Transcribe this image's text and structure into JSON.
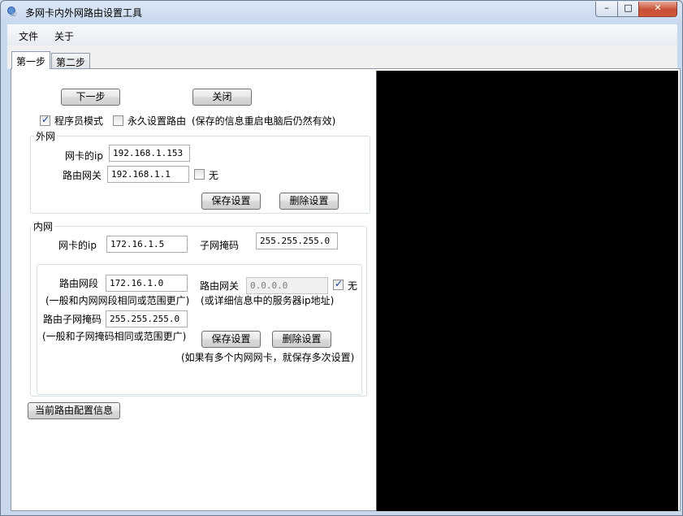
{
  "window": {
    "title": "多网卡内外网路由设置工具"
  },
  "menu": {
    "items": [
      "文件",
      "关于"
    ]
  },
  "tabs": [
    "第一步",
    "第二步"
  ],
  "top_buttons": {
    "next": "下一步",
    "close": "关闭"
  },
  "options": {
    "programmer_mode": {
      "label": "程序员模式",
      "checked": true
    },
    "persistent_route": {
      "label": "永久设置路由",
      "checked": false,
      "note": "(保存的信息重启电脑后仍然有效)"
    }
  },
  "external": {
    "legend": "外网",
    "nic_ip_label": "网卡的ip",
    "nic_ip_value": "192.168.1.153",
    "gateway_label": "路由网关",
    "gateway_value": "192.168.1.1",
    "none_label": "无",
    "none_checked": false,
    "save_label": "保存设置",
    "delete_label": "删除设置"
  },
  "internal": {
    "legend": "内网",
    "nic_ip_label": "网卡的ip",
    "nic_ip_value": "172.16.1.5",
    "subnet_label": "子网掩码",
    "subnet_value": "255.255.255.0",
    "route_segment_label": "路由网段",
    "route_segment_value": "172.16.1.0",
    "route_segment_hint": "(一般和内网网段相同或范围更广)",
    "route_gateway_label": "路由网关",
    "route_gateway_value": "0.0.0.0",
    "route_gateway_hint": "(或详细信息中的服务器ip地址)",
    "none_label": "无",
    "none_checked": true,
    "route_mask_label": "路由子网掩码",
    "route_mask_value": "255.255.255.0",
    "route_mask_hint": "(一般和子网掩码相同或范围更广)",
    "save_label": "保存设置",
    "delete_label": "删除设置",
    "multi_nic_hint": "(如果有多个内网网卡，就保存多次设置)"
  },
  "bottom": {
    "current_config_label": "当前路由配置信息"
  },
  "colors": {
    "panel_bg": "#000000",
    "window_bg": "#ffffff",
    "frame": "#c9d7ea"
  }
}
